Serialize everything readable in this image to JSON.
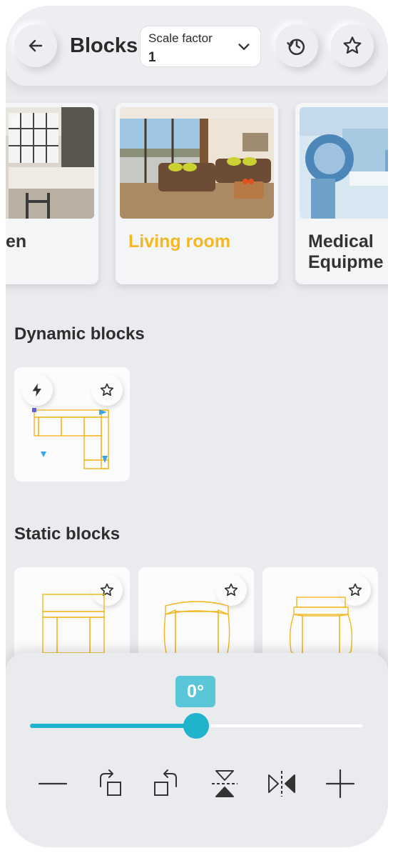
{
  "header": {
    "title": "Blocks",
    "scale_select": {
      "label": "Scale factor",
      "value": "1"
    },
    "icons": [
      "back-arrow-icon",
      "chevron-down-icon",
      "history-icon",
      "star-icon"
    ]
  },
  "categories": [
    {
      "label": "en"
    },
    {
      "label": "Living room",
      "selected": true
    },
    {
      "label_line1": "Medical",
      "label_line2": "Equipme"
    }
  ],
  "dynamic_section": {
    "title": "Dynamic blocks",
    "icons": [
      "lightning-icon",
      "star-icon"
    ]
  },
  "static_section": {
    "title": "Static blocks",
    "count": 3
  },
  "rotation": {
    "value_label": "0°",
    "slider_fraction": 0.5
  },
  "tools": [
    "minus-icon",
    "rotate-right-icon",
    "rotate-left-icon",
    "flip-vertical-icon",
    "flip-horizontal-icon",
    "plus-icon"
  ],
  "colors": {
    "accent": "#1fb3cc",
    "badge": "#59c7d8",
    "selected_label": "#f5b820",
    "block_line": "#f2b51c"
  }
}
